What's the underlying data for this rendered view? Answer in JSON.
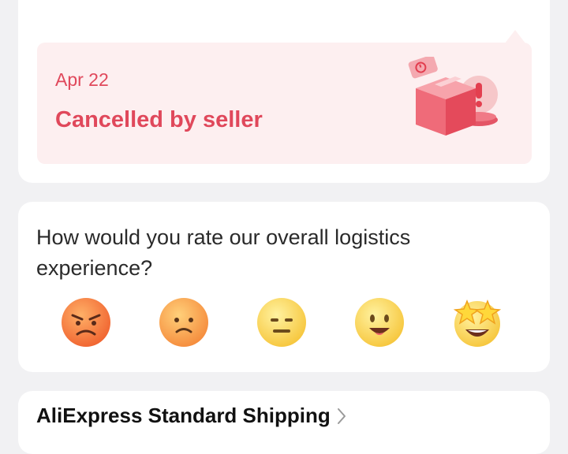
{
  "status": {
    "date": "Apr 22",
    "text": "Cancelled by seller",
    "accent_color": "#e0485b",
    "illustration": "cancelled-package-icon"
  },
  "rating": {
    "question": "How would you rate our overall logistics experience?",
    "options": [
      {
        "icon": "angry-face-icon"
      },
      {
        "icon": "sad-face-icon"
      },
      {
        "icon": "neutral-face-icon"
      },
      {
        "icon": "happy-face-icon"
      },
      {
        "icon": "star-struck-face-icon"
      }
    ]
  },
  "shipping": {
    "method_label": "AliExpress Standard Shipping",
    "chevron_icon": "chevron-right-icon"
  }
}
